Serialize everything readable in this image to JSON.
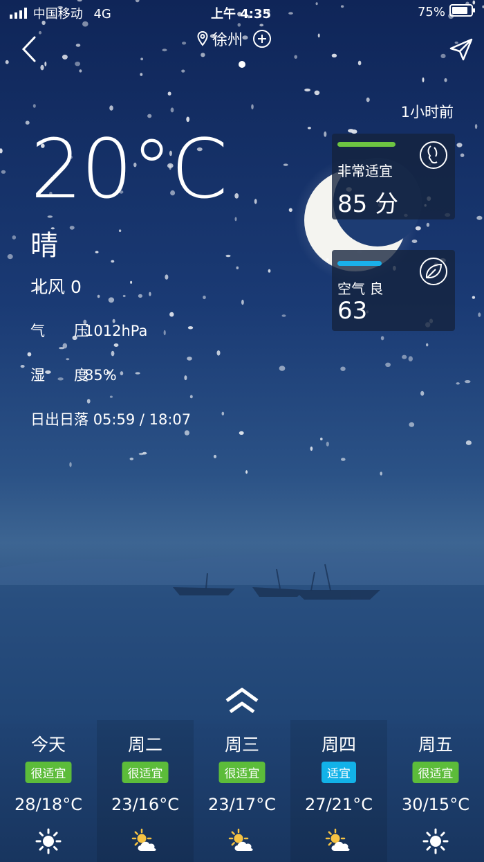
{
  "status_bar": {
    "carrier": "中国移动",
    "network": "4G",
    "time": "上午 4:35",
    "battery": "75%"
  },
  "nav": {
    "city": "徐州"
  },
  "updated": "1小时前",
  "current": {
    "temperature": "20°C",
    "condition": "晴",
    "wind": "北风 0",
    "pressure_label": "气　　压",
    "pressure_value": "1012hPa",
    "humidity_label": "湿　　度",
    "humidity_value": "85%",
    "sun_label": "日出日落",
    "sun_value": "05:59 / 18:07"
  },
  "comfort_card": {
    "label": "非常适宜",
    "value": "85 分",
    "bar_color": "#6dc542",
    "icon": "face-profile-icon"
  },
  "air_card": {
    "label": "空气 良",
    "value": "63",
    "bar_color": "#1ab0ea",
    "icon": "leaf-icon"
  },
  "colors": {
    "good": "#5cbc3a",
    "fair": "#12b2e8"
  },
  "forecast": [
    {
      "day": "今天",
      "badge": "很适宜",
      "badge_color": "#5cbc3a",
      "range": "28/18°C",
      "icon": "sun-icon"
    },
    {
      "day": "周二",
      "badge": "很适宜",
      "badge_color": "#5cbc3a",
      "range": "23/16°C",
      "icon": "partly-cloudy-icon"
    },
    {
      "day": "周三",
      "badge": "很适宜",
      "badge_color": "#5cbc3a",
      "range": "23/17°C",
      "icon": "partly-cloudy-icon"
    },
    {
      "day": "周四",
      "badge": "适宜",
      "badge_color": "#12b2e8",
      "range": "27/21°C",
      "icon": "partly-cloudy-icon"
    },
    {
      "day": "周五",
      "badge": "很适宜",
      "badge_color": "#5cbc3a",
      "range": "30/15°C",
      "icon": "sun-icon"
    }
  ]
}
